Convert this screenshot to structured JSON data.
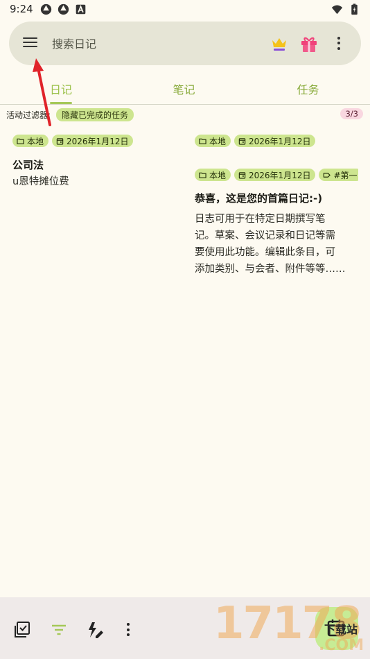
{
  "status_bar": {
    "time": "9:24"
  },
  "search": {
    "placeholder": "搜索日记",
    "value": ""
  },
  "tabs": [
    {
      "label": "日记",
      "active": true
    },
    {
      "label": "笔记",
      "active": false
    },
    {
      "label": "任务",
      "active": false
    }
  ],
  "filter": {
    "label": "活动过滤器:",
    "chip": "隐藏已完成的任务",
    "count": "3/3"
  },
  "cards": [
    {
      "chips": [
        {
          "icon": "folder-icon",
          "text": "本地"
        },
        {
          "icon": "calendar-icon",
          "text": "2026年1月12日"
        }
      ],
      "title": "公司法",
      "body": "u恩特摊位费"
    },
    {
      "chips": [
        {
          "icon": "folder-icon",
          "text": "本地"
        },
        {
          "icon": "calendar-icon",
          "text": "2026年1月12日"
        }
      ],
      "title": "",
      "body": ""
    },
    {
      "chips": [
        {
          "icon": "folder-icon",
          "text": "本地"
        },
        {
          "icon": "calendar-icon",
          "text": "2026年1月12日"
        },
        {
          "icon": "tag-icon",
          "text": "#第一"
        }
      ],
      "title": "恭喜，这是您的首篇日记:-)",
      "body_lines": [
        "日志可用于在特定日期撰写笔",
        "记。草案、会议记录和日记等需",
        "要使用此功能。编辑此条目，可",
        "添加类别、与会者、附件等等……"
      ]
    }
  ],
  "watermark": {
    "text": "17178",
    "sub": "下载站",
    "domain": ".COM"
  },
  "colors": {
    "background": "#fdfaf1",
    "accent_green": "#cde58f",
    "tab_green": "#9cc14a",
    "search_bg": "#e6e5d6",
    "bottom_bar": "#efeae9",
    "fab": "#c7ec95",
    "badge_pink": "#f9d7e0",
    "annotation_red": "#e0232a"
  }
}
